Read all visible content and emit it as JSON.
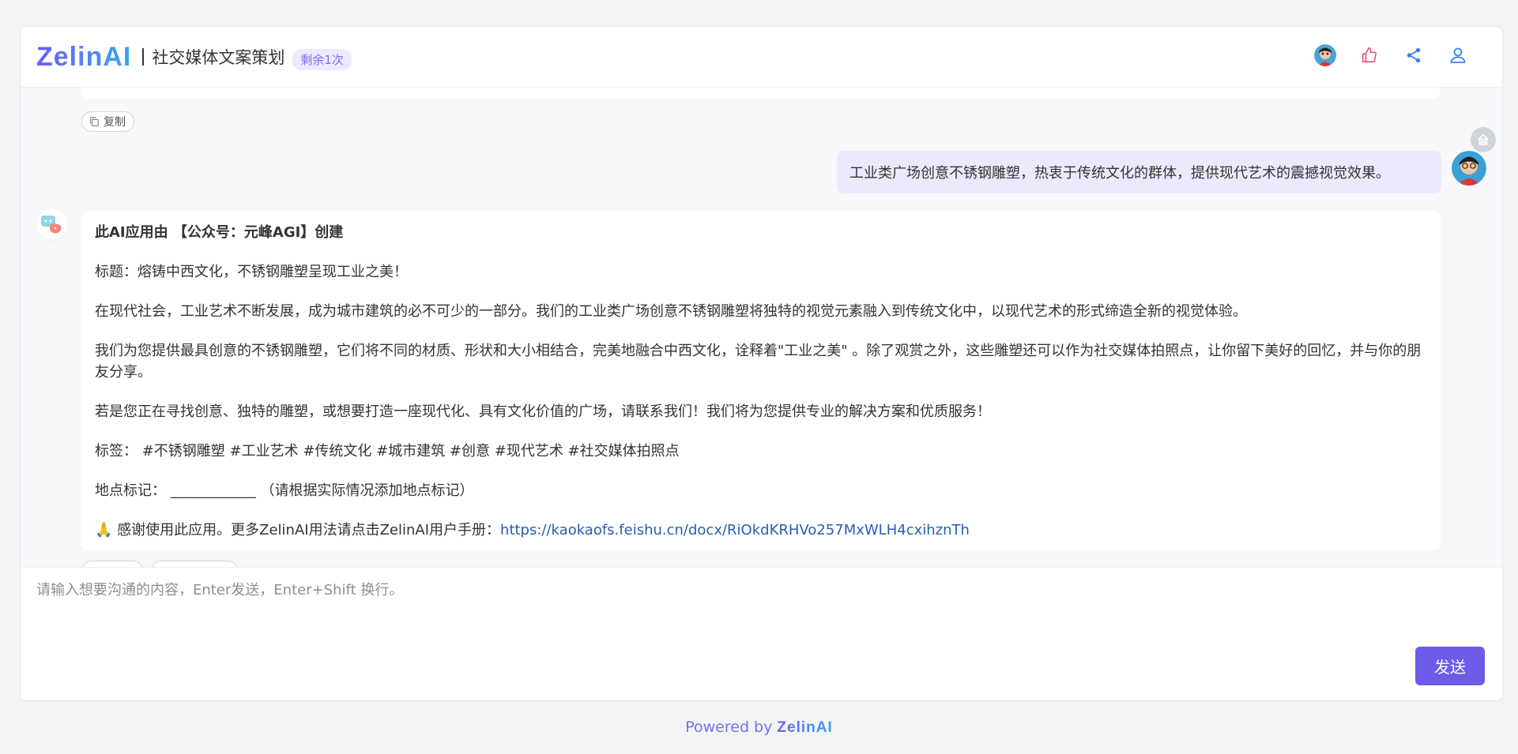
{
  "header": {
    "logo_text": "ZelinAI",
    "app_title": "社交媒体文案策划",
    "quota_badge": "剩余1次"
  },
  "previous_message": {
    "copy_label": "复制"
  },
  "user_message": {
    "text": "工业类广场创意不锈钢雕塑，热衷于传统文化的群体，提供现代艺术的震撼视觉效果。"
  },
  "bot_message": {
    "paragraphs": [
      "此AI应用由 【公众号：元峰AGI】创建",
      "标题：熔铸中西文化，不锈钢雕塑呈现工业之美！",
      "在现代社会，工业艺术不断发展，成为城市建筑的必不可少的一部分。我们的工业类广场创意不锈钢雕塑将独特的视觉元素融入到传统文化中，以现代艺术的形式缔造全新的视觉体验。",
      "我们为您提供最具创意的不锈钢雕塑，它们将不同的材质、形状和大小相结合，完美地融合中西文化，诠释着\"工业之美\" 。除了观赏之外，这些雕塑还可以作为社交媒体拍照点，让你留下美好的回忆，并与你的朋友分享。",
      "若是您正在寻找创意、独特的雕塑，或想要打造一座现代化、具有文化价值的广场，请联系我们！我们将为您提供专业的解决方案和优质服务！",
      "标签： #不锈钢雕塑 #工业艺术 #传统文化 #城市建筑 #创意 #现代艺术 #社交媒体拍照点",
      "地点标记： ____________ （请根据实际情况添加地点标记）"
    ],
    "thanks_text": "感谢使用此应用。更多ZelinAI用法请点击ZelinAI用户手册：",
    "manual_link": "https://kaokaofs.feishu.cn/docx/RiOkdKRHVo257MxWLH4cxihznTh"
  },
  "input": {
    "placeholder": "请输入想要沟通的内容，Enter发送，Enter+Shift 换行。",
    "value": ""
  },
  "send_label": "发送",
  "footer": {
    "powered_by": "Powered by ",
    "brand": "ZelinAI"
  },
  "colors": {
    "accent": "#6c5ce7",
    "badge_bg": "#ede9fe",
    "user_bubble_bg": "#ebe9fc",
    "link": "#2a5db0"
  },
  "icons": [
    "user-avatar",
    "thumbs-up-icon",
    "share-icon",
    "user-icon",
    "copy-icon",
    "home-icon",
    "bot-avatar",
    "hands-emoji-icon"
  ]
}
